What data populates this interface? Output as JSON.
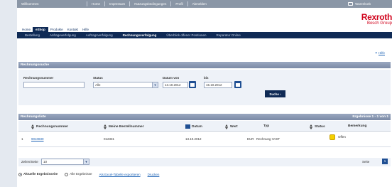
{
  "topbar": {
    "welcome": "Willkommen",
    "links": [
      "Home",
      "Impressum",
      "Nutzungsbedingungen",
      "Profil",
      "Abmelden"
    ],
    "cart": "Warenkorb"
  },
  "brand": {
    "name": "Rexroth",
    "group": "Bosch Group"
  },
  "mainnav": [
    "Home",
    "eShop",
    "Produkte",
    "Kontakt",
    "Hilfe"
  ],
  "mainnav_active": "eShop",
  "subnav": [
    "Bestellung",
    "Anfrageverfolgung",
    "Auftragsverfolgung",
    "Rechnungsverfolgung",
    "Überblick offener Positionen",
    "Reparatur Online"
  ],
  "subnav_active": "Rechnungsverfolgung",
  "help": "Hilfe",
  "search": {
    "title": "Rechnungssuche",
    "invoice_label": "Rechnungsnummer",
    "invoice_value": "",
    "status_label": "Status",
    "status_value": "Alle",
    "date_from_label": "Datum von",
    "date_from_value": "13.10.2012",
    "date_to_label": "bis",
    "date_to_value": "15.10.2012",
    "button": "Suche ›"
  },
  "list": {
    "title": "Rechnungsliste",
    "results": "Ergebnisse 1 - 1 von 1",
    "columns": [
      "Rechnungsnummer",
      "Meine Bestellnummer",
      "Datum",
      "Wert",
      "Typ",
      "Status",
      "Bemerkung"
    ],
    "rows": [
      {
        "index": "1",
        "invoice": "9010830",
        "order": "012331",
        "date": "13.10.2012",
        "value": "",
        "currency": "EUR",
        "type": "Rechnung VAST",
        "status": "Offen",
        "remark": ""
      }
    ]
  },
  "paging": {
    "rows_label": "Zeilen/Seite",
    "rows_value": "10",
    "page_label": "Seite",
    "page_value": "1"
  },
  "export": {
    "current_label": "Aktuelle Ergebnisseite",
    "all_label": "Alle Ergebnisse",
    "excel_link": "Als Excel-Tabelle exportieren",
    "print_link": "Drucken"
  },
  "colors": {
    "navy": "#0f2a55",
    "header_bar": "#8a96a6",
    "brand_red": "#d0021b",
    "link": "#1e63b5",
    "status_yellow": "#f5d000"
  }
}
